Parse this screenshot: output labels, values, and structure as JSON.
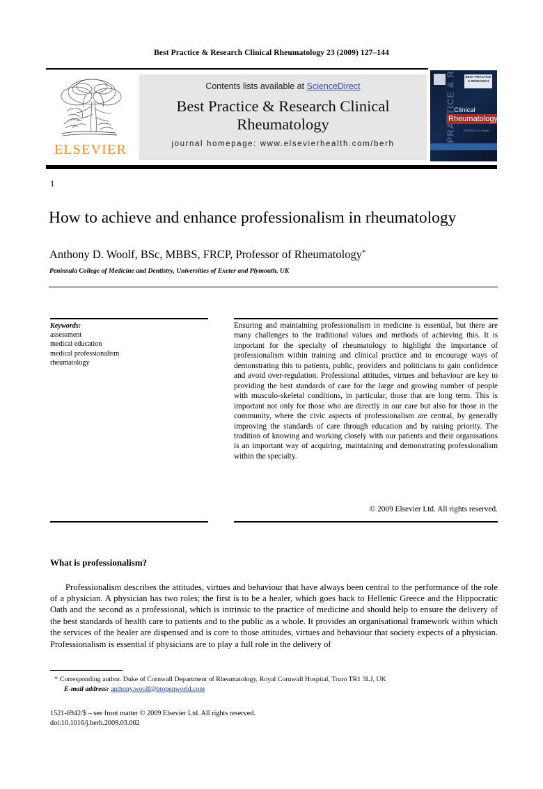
{
  "running_head": "Best Practice & Research Clinical Rheumatology 23 (2009) 127–144",
  "masthead": {
    "contents_prefix": "Contents lists available at ",
    "sciencedirect": "ScienceDirect",
    "journal_title_line1": "Best Practice & Research Clinical",
    "journal_title_line2": "Rheumatology",
    "homepage": "journal homepage: www.elsevierhealth.com/berh",
    "publisher_wordmark": "ELSEVIER",
    "publisher_accent_color": "#F08B1D",
    "sciencedirect_link_color": "#3b4ba8"
  },
  "cover": {
    "vertical_text": "PRACTICE & RESEARCH",
    "badge_text": "BEST PRACTICE & RESEARCH",
    "title_small": "Clinical",
    "title_highlight": "Rheumatology",
    "editor_line": "EDITOR\nA. D. Woolf",
    "background_color": "#0d1b35",
    "highlight_color": "#9d2f2f"
  },
  "article": {
    "number": "1",
    "title": "How to achieve and enhance professionalism in rheumatology",
    "author": "Anthony D. Woolf, BSc, MBBS, FRCP, Professor of Rheumatology",
    "author_marker": "*",
    "affiliation": "Peninsula College of Medicine and Dentistry, Universities of Exeter and Plymouth, UK"
  },
  "keywords": {
    "heading": "Keywords:",
    "items": [
      "assessment",
      "medical education",
      "medical professionalism",
      "rheumatology"
    ]
  },
  "abstract": {
    "text": "Ensuring and maintaining professionalism in medicine is essential, but there are many challenges to the traditional values and methods of achieving this. It is important for the specialty of rheumatology to highlight the importance of professionalism within training and clinical practice and to encourage ways of demonstrating this to patients, public, providers and politicians to gain confidence and avoid over-regulation. Professional attitudes, virtues and behaviour are key to providing the best standards of care for the large and growing number of people with musculo-skeletal conditions, in particular, those that are long term. This is important not only for those who are directly in our care but also for those in the community, where the civic aspects of professionalism are central, by generally improving the standards of care through education and by raising priority. The tradition of knowing and working closely with our patients and their organisations is an important way of acquiring, maintaining and demonstrating professionalism within the specialty.",
    "copyright": "© 2009 Elsevier Ltd. All rights reserved."
  },
  "body": {
    "section_heading": "What is professionalism?",
    "paragraph": "Professionalism describes the attitudes, virtues and behaviour that have always been central to the performance of the role of a physician. A physician has two roles; the first is to be a healer, which goes back to Hellenic Greece and the Hippocratic Oath and the second as a professional, which is intrinsic to the practice of medicine and should help to ensure the delivery of the best standards of health care to patients and to the public as a whole. It provides an organisational framework within which the services of the healer are dispensed and is core to those attitudes, virtues and behaviour that society expects of a physician. Professionalism is essential if physicians are to play a full role in the delivery of"
  },
  "footnote": {
    "marker": "*",
    "corresponding": "Corresponding author. Duke of Cornwall Department of Rheumatology, Royal Cornwall Hospital, Truro TR1 3LJ, UK",
    "email_label": "E-mail address:",
    "email": "anthony.woolf@btopenworld.com",
    "issn_line": "1521-6942/$ – see front matter © 2009 Elsevier Ltd. All rights reserved.",
    "doi_line": "doi:10.1016/j.berh.2009.03.002"
  }
}
